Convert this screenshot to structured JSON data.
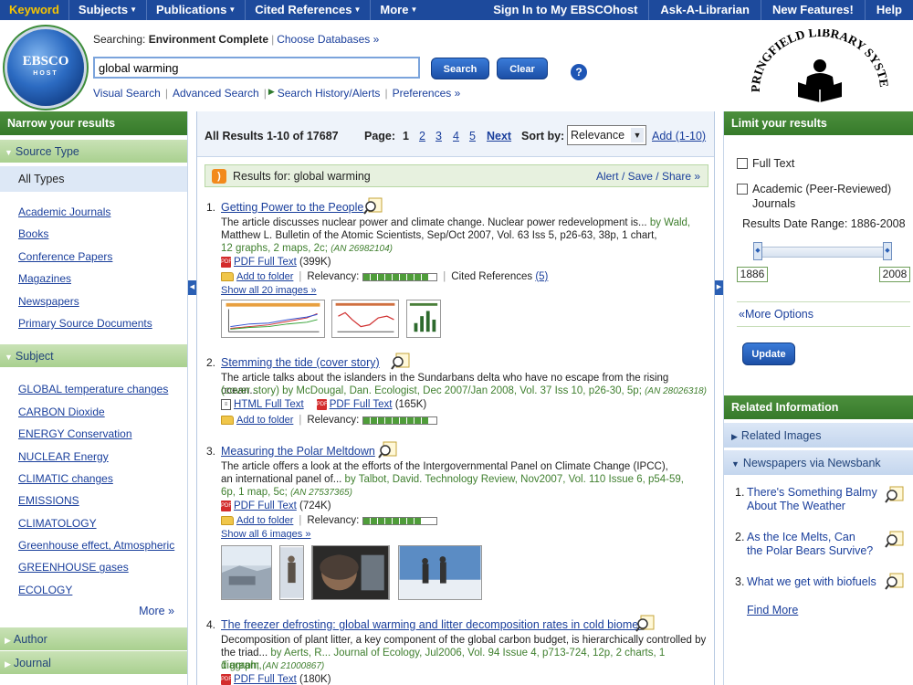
{
  "topnav": {
    "items": [
      {
        "label": "Keyword",
        "active": true,
        "caret": false
      },
      {
        "label": "Subjects",
        "caret": true
      },
      {
        "label": "Publications",
        "caret": true
      },
      {
        "label": "Cited References",
        "caret": true
      },
      {
        "label": "More",
        "caret": true
      }
    ],
    "right": [
      "Sign In to My EBSCOhost",
      "Ask-A-Librarian",
      "New Features!",
      "Help"
    ]
  },
  "logo": {
    "top": "EBSCO",
    "bottom": "HOST"
  },
  "header": {
    "searching_label": "Searching:",
    "database": "Environment Complete",
    "choose_db": "Choose Databases »",
    "search_value": "global warming",
    "search_btn": "Search",
    "clear_btn": "Clear",
    "help": "?",
    "links": [
      "Visual Search",
      "Advanced Search",
      "Search History/Alerts",
      "Preferences »"
    ]
  },
  "springfield": {
    "text": "SPRINGFIELD LIBRARY SYSTEM"
  },
  "left": {
    "narrow_title": "Narrow your results",
    "source_type_title": "Source Type",
    "all_types": "All Types",
    "source_types": [
      "Academic Journals",
      "Books",
      "Conference Papers",
      "Magazines",
      "Newspapers",
      "Primary Source Documents"
    ],
    "subject_title": "Subject",
    "subjects": [
      "GLOBAL temperature changes",
      "CARBON Dioxide",
      "ENERGY Conservation",
      "NUCLEAR Energy",
      "CLIMATIC changes",
      "EMISSIONS",
      "CLIMATOLOGY",
      "Greenhouse effect, Atmospheric",
      "GREENHOUSE gases",
      "ECOLOGY"
    ],
    "more": "More »",
    "author_title": "Author",
    "journal_title": "Journal"
  },
  "main": {
    "all_results": "All Results 1-10 of 17687",
    "page_label": "Page:",
    "pages": [
      "1",
      "2",
      "3",
      "4",
      "5"
    ],
    "next": "Next",
    "sort_label": "Sort by:",
    "sort_value": "Relevance",
    "add": "Add (1-10)",
    "results_for": "Results for: global warming",
    "alert": "Alert / Save / Share »",
    "add_to_folder": "Add to folder",
    "relevancy": "Relevancy:",
    "results": [
      {
        "num": "1.",
        "title": "Getting Power to the People",
        "desc1": "The article discusses nuclear power and climate change. Nuclear power redevelopment is...",
        "desc1_green": " by Wald,",
        "desc2_green": "Matthew L. Bulletin of the Atomic Scientists, Sep/Oct 2007, Vol. 63 Iss 5, p26-63, 38p, 1 chart,",
        "desc3_green": "12 graphs, 2 maps, 2c;",
        "an": "(AN 26982104)",
        "pdf": "PDF Full Text",
        "pdf_size": "(399K)",
        "relevancy": 0.9,
        "cited": "Cited References",
        "cited_count": "(5)",
        "show_all": "Show all 20 images »"
      },
      {
        "num": "2.",
        "title": "Stemming the tide (cover story)",
        "desc1": "The article talks about the islanders in the Sundarbans delta who have no escape from the rising ocean...",
        "desc2_green": "(cover story) by McDougal, Dan. Ecologist, Dec 2007/Jan 2008, Vol. 37 Iss 10, p26-30, 5p;",
        "an": "(AN 28026318)",
        "html": "HTML Full Text",
        "pdf": "PDF Full Text",
        "pdf_size": "(165K)",
        "relevancy": 0.9
      },
      {
        "num": "3.",
        "title": "Measuring the Polar Meltdown",
        "desc1": "The article offers a look at the efforts of the Intergovernmental Panel on Climate Change (IPCC),",
        "desc2": "an international panel of...",
        "desc2_green": " by Talbot, David. Technology Review, Nov2007, Vol. 110 Issue 6, p54-59,",
        "desc3_green": "6p, 1 map, 5c;",
        "an": "(AN 27537365)",
        "pdf": "PDF Full Text",
        "pdf_size": "(724K)",
        "relevancy": 0.8,
        "show_all": "Show all 6 images »"
      },
      {
        "num": "4.",
        "title": "The freezer defrosting: global warming and litter decomposition rates in cold biomes",
        "desc1": "Decomposition of plant litter, a key component of the global carbon budget, is hierarchically controlled by",
        "desc2": "the triad...",
        "desc2_green": " by Aerts, R... Journal of Ecology, Jul2006, Vol. 94 Issue 4, p713-724, 12p, 2 charts, 1 diagram,",
        "desc3_green": "1 graph;",
        "an": "(AN 21000867)",
        "pdf": "PDF Full Text",
        "pdf_size": "(180K)"
      }
    ]
  },
  "right": {
    "limit_title": "Limit your results",
    "full_text": "Full Text",
    "academic": "Academic (Peer-Reviewed)",
    "academic2": "Journals",
    "date_range": "Results Date Range: 1886-2008",
    "date_from": "1886",
    "date_to": "2008",
    "more_options": "«More Options",
    "update": "Update",
    "related_title": "Related Information",
    "related_images": "Related Images",
    "newspapers": "Newspapers via Newsbank",
    "news": [
      {
        "num": "1.",
        "l1": "There's Something Balmy",
        "l2": "About The Weather"
      },
      {
        "num": "2.",
        "l1": "As the Ice Melts, Can",
        "l2": "the Polar Bears Survive?"
      },
      {
        "num": "3.",
        "l1": "What we get with biofuels",
        "l2": ""
      }
    ],
    "find_more": "Find More"
  }
}
